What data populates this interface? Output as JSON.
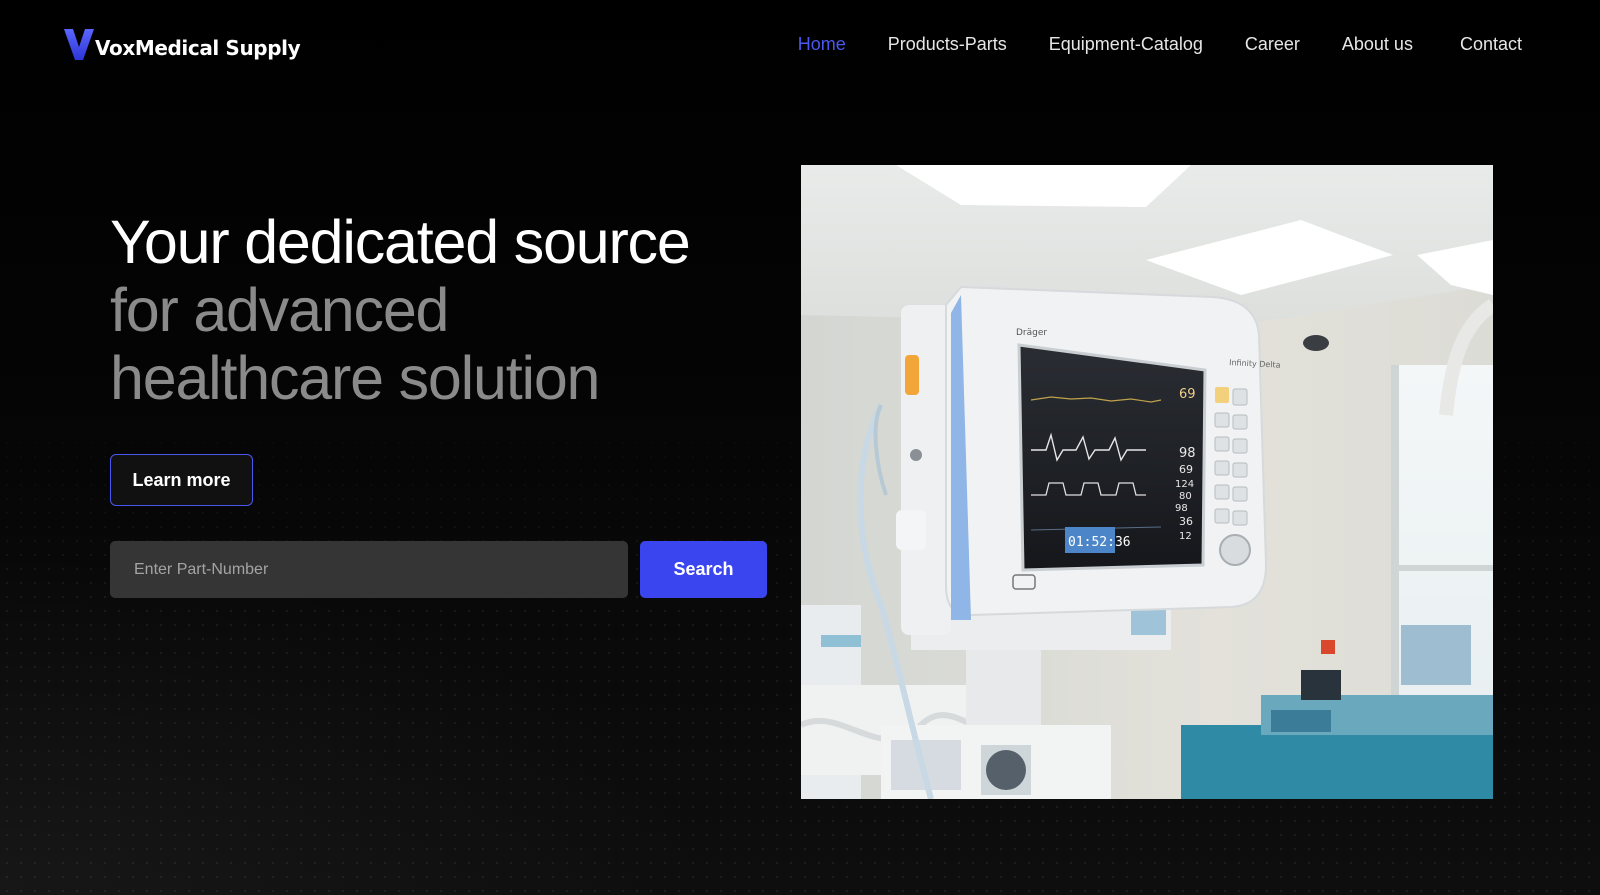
{
  "brand": {
    "name": "VoxMedical Supply",
    "logo_letter": "V",
    "accent": "#4a58f0"
  },
  "nav": {
    "items": [
      {
        "label": "Home",
        "active": true
      },
      {
        "label": "Products-Parts",
        "active": false
      },
      {
        "label": "Equipment-Catalog",
        "active": false
      },
      {
        "label": "Career",
        "active": false
      },
      {
        "label": "About us",
        "active": false
      },
      {
        "label": "Contact",
        "active": false
      }
    ]
  },
  "hero": {
    "headline_line1": "Your dedicated source",
    "headline_line2": "for advanced",
    "headline_line3": "healthcare solution",
    "learn_more_label": "Learn more",
    "search_placeholder": "Enter Part-Number",
    "search_value": "",
    "search_button_label": "Search",
    "search_button_color": "#3b45ef"
  },
  "image": {
    "subject": "patient-monitor-in-operating-room",
    "monitor_brand": "Dräger",
    "monitor_model": "Infinity Delta",
    "readouts": {
      "timer": "01:52:36",
      "v1": "69",
      "v2": "98",
      "v3": "69",
      "v4": "124",
      "v5": "80",
      "v6": "98",
      "v7": "36",
      "v8": "12"
    }
  }
}
